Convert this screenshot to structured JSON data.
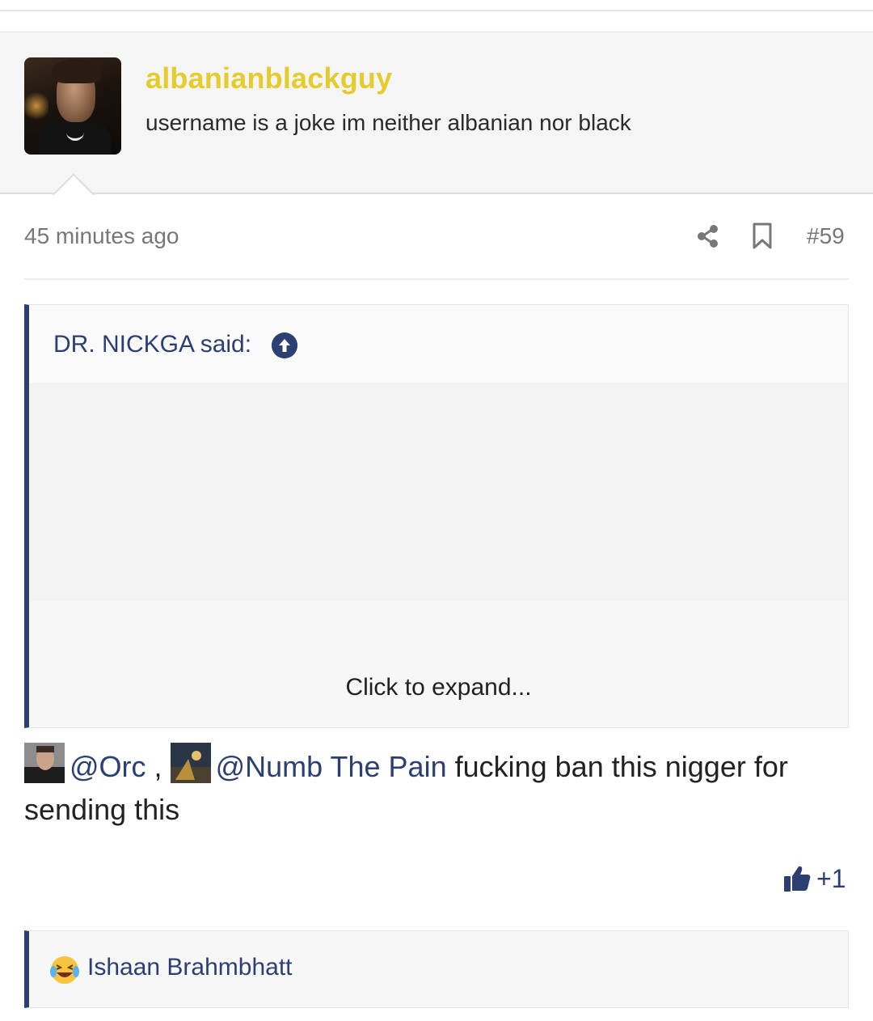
{
  "post": {
    "author": {
      "username": "albanianblackguy",
      "user_title": "username is a joke im neither albanian nor black"
    },
    "timestamp": "45 minutes ago",
    "post_number": "#59",
    "quote": {
      "author_label": "DR. NICKGA said:",
      "expand_label": "Click to expand..."
    },
    "message": {
      "mention_1": "@Orc",
      "separator": " ,",
      "mention_2": "@Numb The Pain",
      "text_line": " fucking ban this nigger for sending this"
    },
    "like_count": "+1",
    "reactions": {
      "reactor_name": "Ishaan Brahmbhatt"
    }
  },
  "colors": {
    "username": "#e5cb2b",
    "accent": "#2b3f73",
    "muted": "#777777"
  },
  "icons": [
    "share-icon",
    "bookmark-icon",
    "arrow-up-icon",
    "thumbs-up-icon",
    "laughing-crying-emoji-icon"
  ]
}
